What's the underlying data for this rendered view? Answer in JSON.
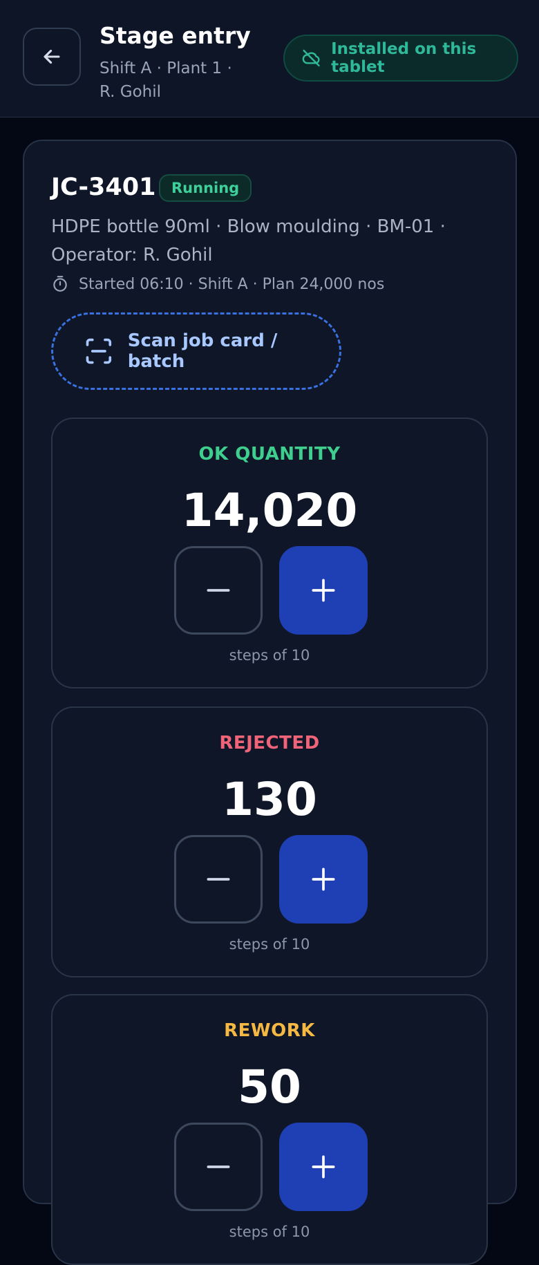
{
  "header": {
    "title": "Stage entry",
    "subtitle": "Shift A · Plant 1 · R. Gohil",
    "install_label": "Installed on this tablet",
    "icons": {
      "back": "arrow-left-icon",
      "install": "cloud-off-icon"
    }
  },
  "job": {
    "id": "JC-3401",
    "status": "Running",
    "description": "HDPE bottle 90ml · Blow moulding · BM-01 · Operator: R. Gohil",
    "meta": "Started 06:10 · Shift A · Plan 24,000 nos",
    "scan_label": "Scan job card / batch",
    "icons": {
      "meta": "timer-icon",
      "scan": "scan-icon"
    }
  },
  "counters": [
    {
      "label": "OK QUANTITY",
      "value": "14,020",
      "step": "steps of 10",
      "color": "#3ecf8e"
    },
    {
      "label": "REJECTED",
      "value": "130",
      "step": "steps of 10",
      "color": "#f0647a"
    },
    {
      "label": "REWORK",
      "value": "50",
      "step": "steps of 10",
      "color": "#f5b843"
    }
  ],
  "colors": {
    "accent": "#1f3fb4",
    "ok": "#3ecf8e",
    "rejected": "#f0647a",
    "rework": "#f5b843",
    "installed": "#2fb99a"
  }
}
